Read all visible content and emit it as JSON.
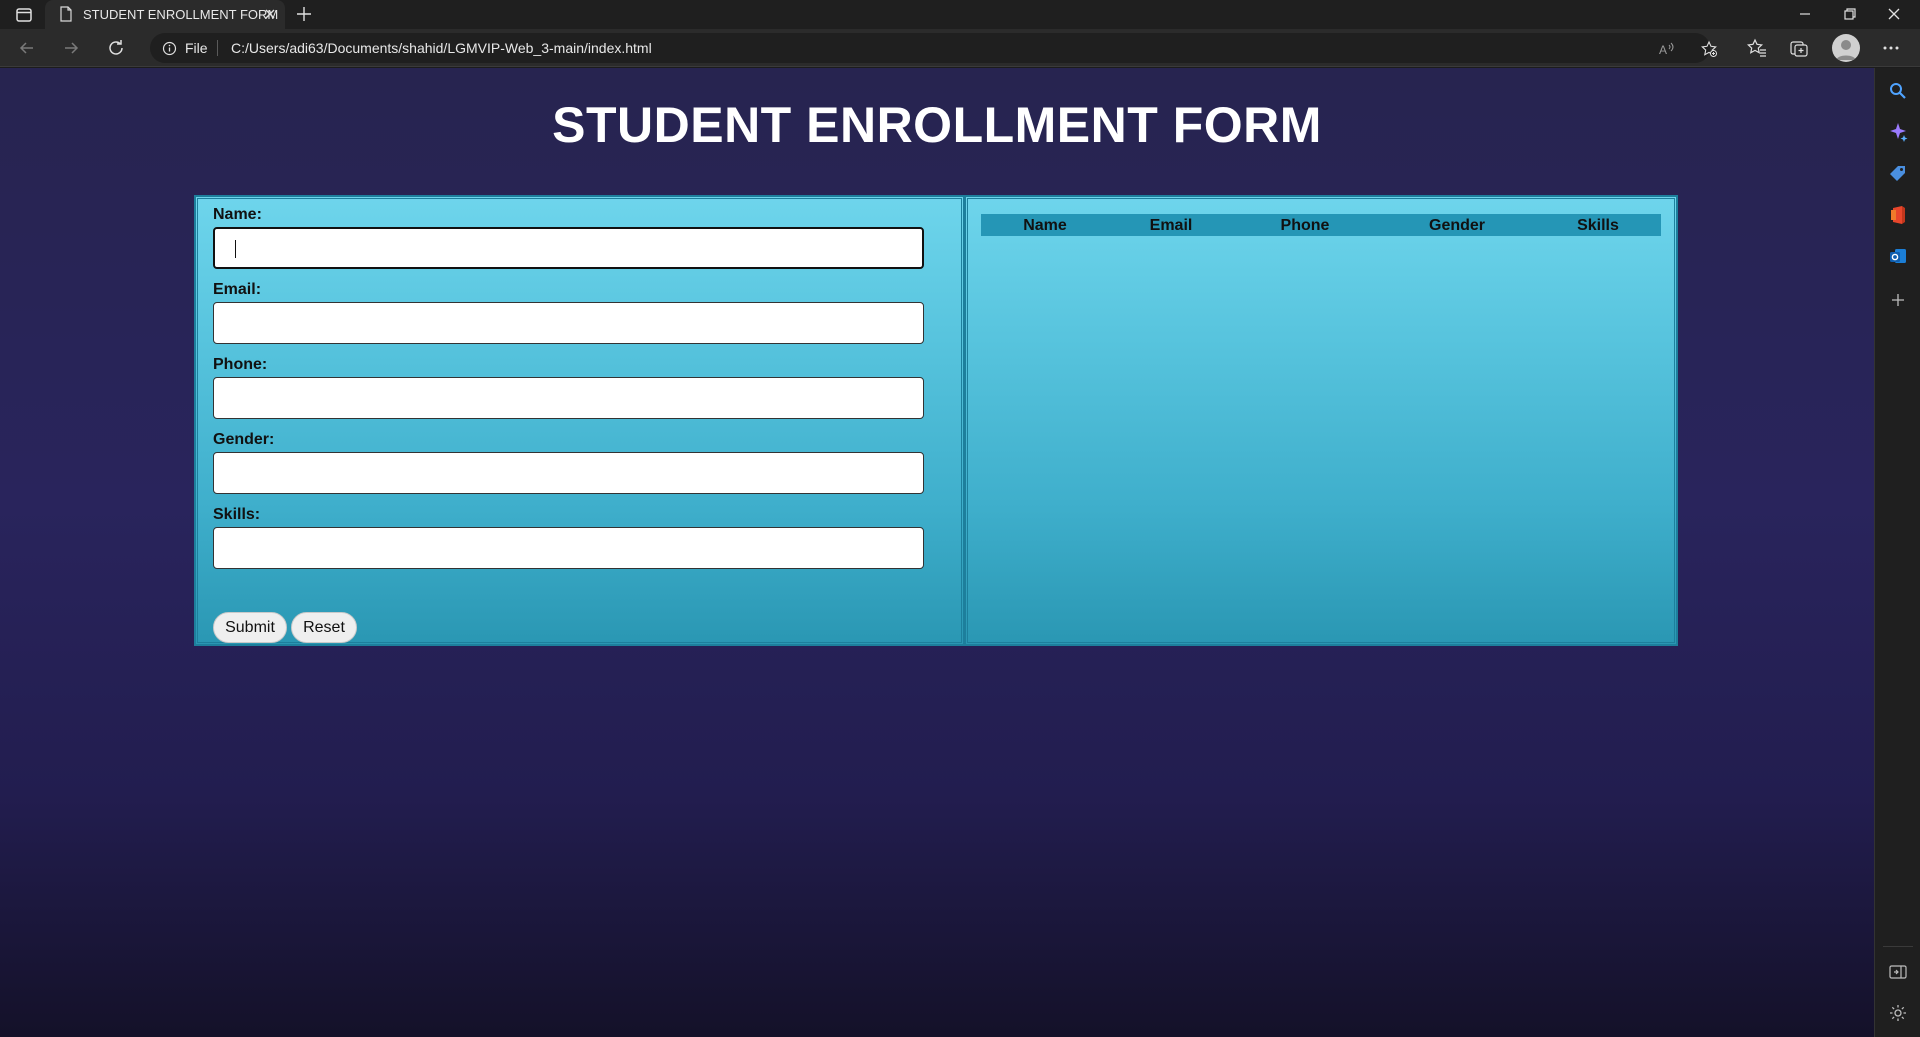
{
  "browser": {
    "tab_title": "STUDENT ENROLLMENT FORM",
    "file_label": "File",
    "url": "C:/Users/adi63/Documents/shahid/LGMVIP-Web_3-main/index.html"
  },
  "page": {
    "title": "STUDENT ENROLLMENT FORM",
    "form": {
      "fields": [
        {
          "label": "Name:",
          "value": "",
          "focused": true
        },
        {
          "label": "Email:",
          "value": ""
        },
        {
          "label": "Phone:",
          "value": ""
        },
        {
          "label": "Gender:",
          "value": ""
        },
        {
          "label": "Skills:",
          "value": ""
        }
      ],
      "submit_label": "Submit",
      "reset_label": "Reset"
    },
    "table": {
      "headers": [
        "Name",
        "Email",
        "Phone",
        "Gender",
        "Skills"
      ],
      "rows": []
    }
  },
  "colors": {
    "page_background": "#29245c",
    "card_top": "#6ed5ec",
    "card_bottom": "#2a97b3",
    "table_header": "#2596b6"
  }
}
